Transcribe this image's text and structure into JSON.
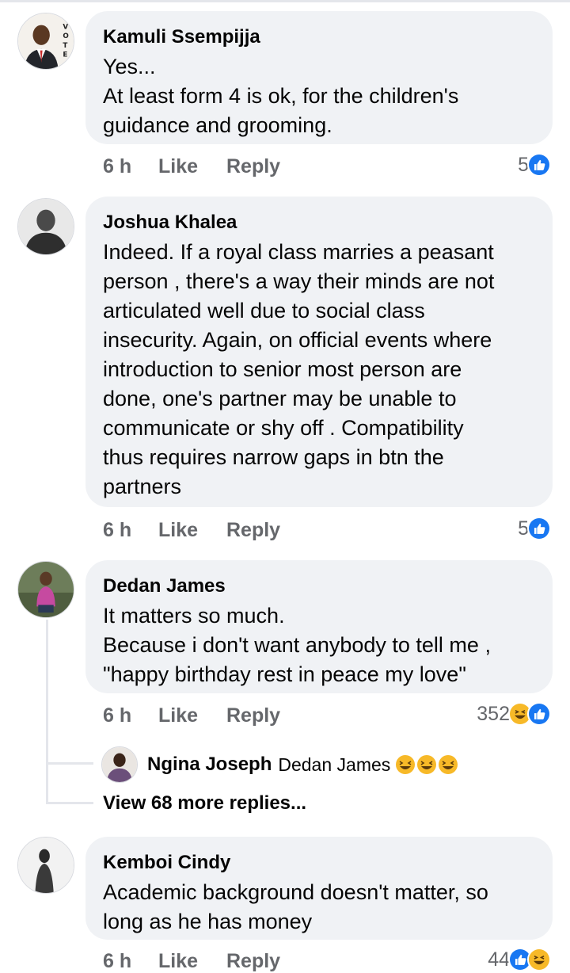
{
  "comments": [
    {
      "author": "Kamuli Ssempijja",
      "avatar_icon": "profile-photo-man-suit-vote",
      "lines": [
        "Yes...",
        "At least form 4 is ok, for the children's",
        "guidance and grooming."
      ],
      "time": "6 h",
      "like_label": "Like",
      "reply_label": "Reply",
      "reaction_count": "5",
      "reaction_icons": [
        "like-reaction-icon"
      ]
    },
    {
      "author": "Joshua Khalea",
      "avatar_icon": "profile-photo-man-grayscale",
      "lines": [
        "Indeed. If a royal class marries a peasant",
        "person , there's a way their minds are not",
        "articulated well due to social class",
        "insecurity. Again, on official events where",
        "introduction to senior most person are",
        "done, one's partner may be unable to",
        "communicate or shy off . Compatibility",
        "thus requires narrow gaps in btn the",
        "partners"
      ],
      "time": "6 h",
      "like_label": "Like",
      "reply_label": "Reply",
      "reaction_count": "5",
      "reaction_icons": [
        "like-reaction-icon"
      ]
    },
    {
      "author": "Dedan James",
      "avatar_icon": "profile-photo-man-outdoor",
      "lines": [
        "It matters so much.",
        "Because i don't want anybody to tell me ,",
        "\"happy birthday rest in peace my love\""
      ],
      "time": "6 h",
      "like_label": "Like",
      "reply_label": "Reply",
      "reaction_count": "352",
      "reaction_icons": [
        "haha-reaction-icon",
        "like-reaction-icon"
      ]
    },
    {
      "author": "Kemboi Cindy",
      "avatar_icon": "profile-photo-woman-grayscale",
      "lines": [
        "Academic background doesn't matter, so",
        "long as he has money"
      ],
      "time": "6 h",
      "like_label": "Like",
      "reply_label": "Reply",
      "reaction_count": "44",
      "reaction_icons": [
        "like-reaction-icon",
        "haha-reaction-icon"
      ]
    }
  ],
  "reply_preview": {
    "author": "Ngina Joseph",
    "text": "Dedan James",
    "emojis": [
      "rolling-laughing-emoji",
      "rolling-laughing-emoji",
      "rolling-laughing-emoji"
    ]
  },
  "view_more_label": "View 68 more replies...",
  "colors": {
    "bubble_bg": "#f0f2f5",
    "meta_text": "#65676b",
    "like_blue": "#1877f2",
    "haha_yellow": "#f7b928"
  }
}
